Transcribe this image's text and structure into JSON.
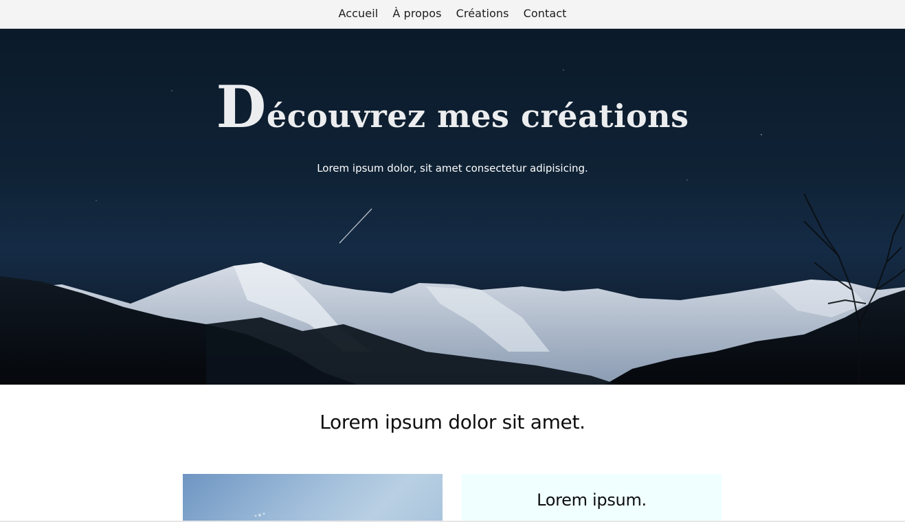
{
  "nav": {
    "items": [
      {
        "label": "Accueil"
      },
      {
        "label": "À propos"
      },
      {
        "label": "Créations"
      },
      {
        "label": "Contact"
      }
    ]
  },
  "hero": {
    "title_initial": "D",
    "title_rest": "écouvrez mes créations",
    "subtitle": "Lorem ipsum dolor, sit amet consectetur adipisicing."
  },
  "section": {
    "title": "Lorem ipsum dolor sit amet.",
    "card_heading": "Lorem ipsum."
  },
  "colors": {
    "nav_background": "#f4f4f4",
    "hero_sky": "#0f2235",
    "card_background": "#f0ffff",
    "text_dark": "#0d0d0d"
  }
}
